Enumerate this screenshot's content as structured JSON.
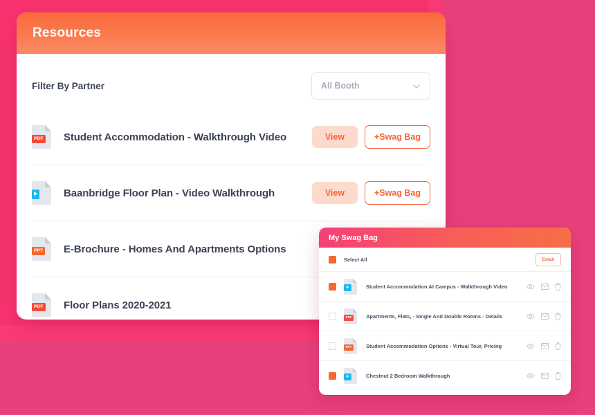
{
  "theme": {
    "bg_pink": "#e8407c",
    "layer_pink_bright": "#fb3a75",
    "layer_pink_mid": "#f7336f",
    "accent_orange": "#f4663a",
    "header_gradient_from": "#f8693b",
    "header_gradient_to": "#fa8a63",
    "swag_gradient_from": "#f63f77",
    "swag_gradient_to": "#f76e45",
    "pdf_badge": "#f44c38",
    "ppt_badge": "#f4692f",
    "video_badge": "#1cb9f0"
  },
  "resources_card": {
    "title": "Resources",
    "filter": {
      "label": "Filter By Partner",
      "select_value": "All Booth",
      "select_placeholder": "All Booth",
      "chevron_icon": "chevron-down-icon",
      "options": [
        "All Booth"
      ]
    },
    "buttons": {
      "view_label": "View",
      "swag_label": "+Swag Bag"
    },
    "items": [
      {
        "title": "Student Accommodation - Walkthrough Video",
        "file_type": "PDF",
        "icon": "pdf-file-icon",
        "has_actions": true
      },
      {
        "title": "Baanbridge Floor Plan - Video Walkthrough",
        "file_type": "VIDEO",
        "icon": "video-file-icon",
        "has_actions": true
      },
      {
        "title": "E-Brochure - Homes And Apartments Options",
        "file_type": "PPT",
        "icon": "ppt-file-icon",
        "has_actions": false
      },
      {
        "title": "Floor Plans 2020-2021",
        "file_type": "PDF",
        "icon": "pdf-file-icon",
        "has_actions": false
      }
    ]
  },
  "swag_bag": {
    "title": "My Swag Bag",
    "select_all_label": "Select All",
    "select_all_checked": true,
    "email_label": "Email",
    "row_icons": {
      "view": "eye-icon",
      "email": "envelope-icon",
      "delete": "trash-icon"
    },
    "items": [
      {
        "title": "Student Accommodation At Campus - Walkthrough Video",
        "file_type": "VIDEO",
        "icon": "video-file-icon",
        "checked": true
      },
      {
        "title": "Apartments, Flats, - Single And Double Rooms - Details",
        "file_type": "PDF",
        "icon": "pdf-file-icon",
        "checked": false
      },
      {
        "title": "Student Accommodation Options - Virtual Tour, Pricing",
        "file_type": "PPT",
        "icon": "ppt-file-icon",
        "checked": false
      },
      {
        "title": "Chestnut 2 Bedroom Walkthrough",
        "file_type": "VIDEO",
        "icon": "video-file-icon",
        "checked": true
      }
    ]
  }
}
